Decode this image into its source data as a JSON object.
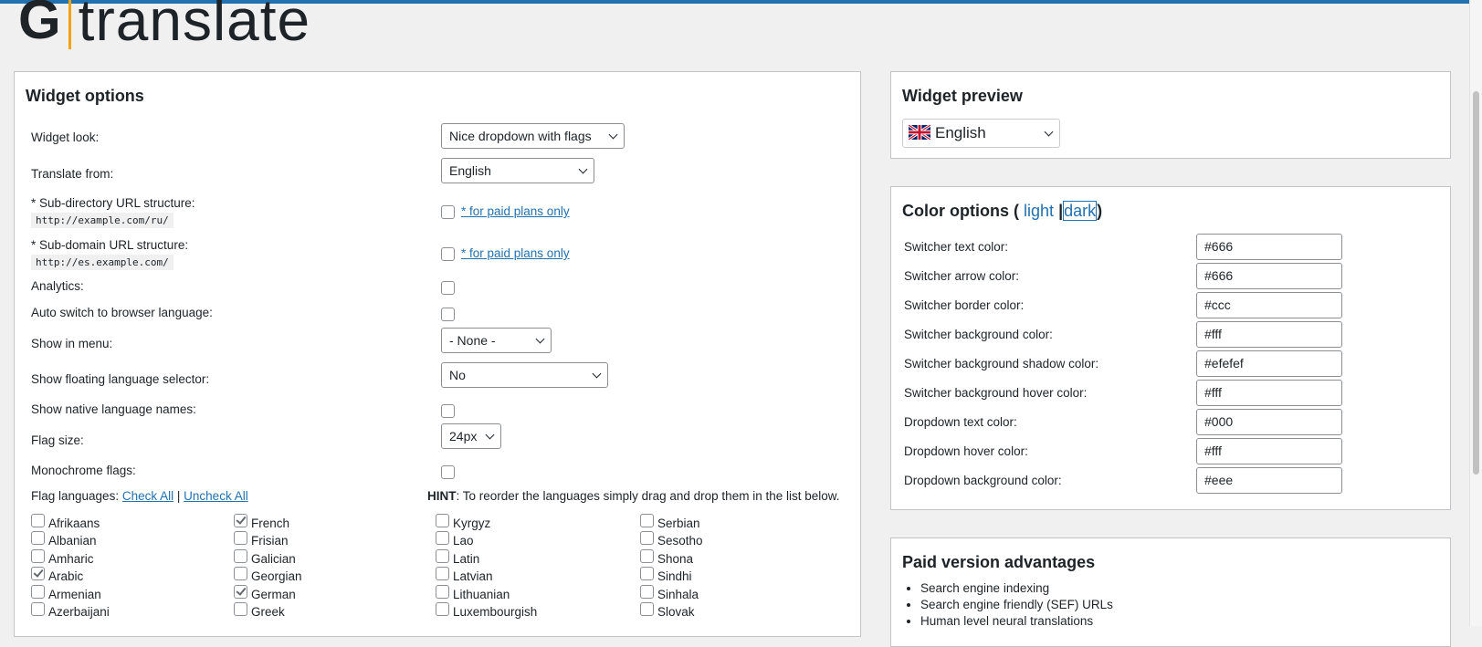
{
  "logo": {
    "mark": "G",
    "text": "translate"
  },
  "widget_options": {
    "title": "Widget options",
    "widget_look": {
      "label": "Widget look:",
      "value": "Nice dropdown with flags"
    },
    "translate_from": {
      "label": "Translate from:",
      "value": "English"
    },
    "subdirectory": {
      "label": "* Sub-directory URL structure:",
      "example": "http://example.com/ru/",
      "link": "* for paid plans only"
    },
    "subdomain": {
      "label": "* Sub-domain URL structure:",
      "example": "http://es.example.com/",
      "link": "* for paid plans only"
    },
    "analytics": {
      "label": "Analytics:"
    },
    "auto_switch": {
      "label": "Auto switch to browser language:"
    },
    "show_in_menu": {
      "label": "Show in menu:",
      "value": "- None -"
    },
    "floating": {
      "label": "Show floating language selector:",
      "value": "No"
    },
    "native_names": {
      "label": "Show native language names:"
    },
    "flag_size": {
      "label": "Flag size:",
      "value": "24px"
    },
    "monochrome": {
      "label": "Monochrome flags:"
    },
    "flag_languages": {
      "label": "Flag languages:",
      "check_all": "Check All",
      "separator": "|",
      "uncheck_all": "Uncheck All"
    },
    "hint": {
      "bold": "HINT",
      "text": ": To reorder the languages simply drag and drop them in the list below."
    },
    "languages": [
      [
        {
          "name": "Afrikaans",
          "checked": false
        },
        {
          "name": "Albanian",
          "checked": false
        },
        {
          "name": "Amharic",
          "checked": false
        },
        {
          "name": "Arabic",
          "checked": true
        },
        {
          "name": "Armenian",
          "checked": false
        },
        {
          "name": "Azerbaijani",
          "checked": false
        }
      ],
      [
        {
          "name": "French",
          "checked": true
        },
        {
          "name": "Frisian",
          "checked": false
        },
        {
          "name": "Galician",
          "checked": false
        },
        {
          "name": "Georgian",
          "checked": false
        },
        {
          "name": "German",
          "checked": true
        },
        {
          "name": "Greek",
          "checked": false
        }
      ],
      [
        {
          "name": "Kyrgyz",
          "checked": false
        },
        {
          "name": "Lao",
          "checked": false
        },
        {
          "name": "Latin",
          "checked": false
        },
        {
          "name": "Latvian",
          "checked": false
        },
        {
          "name": "Lithuanian",
          "checked": false
        },
        {
          "name": "Luxembourgish",
          "checked": false
        }
      ],
      [
        {
          "name": "Serbian",
          "checked": false
        },
        {
          "name": "Sesotho",
          "checked": false
        },
        {
          "name": "Shona",
          "checked": false
        },
        {
          "name": "Sindhi",
          "checked": false
        },
        {
          "name": "Sinhala",
          "checked": false
        },
        {
          "name": "Slovak",
          "checked": false
        }
      ]
    ]
  },
  "widget_preview": {
    "title": "Widget preview",
    "value": "English",
    "flag_icon": "uk-flag-icon"
  },
  "color_options": {
    "title": "Color options",
    "open": "(",
    "light": "light",
    "sep": "|",
    "dark": "dark",
    "close": ")",
    "fields": [
      {
        "label": "Switcher text color:",
        "value": "#666"
      },
      {
        "label": "Switcher arrow color:",
        "value": "#666"
      },
      {
        "label": "Switcher border color:",
        "value": "#ccc"
      },
      {
        "label": "Switcher background color:",
        "value": "#fff"
      },
      {
        "label": "Switcher background shadow color:",
        "value": "#efefef"
      },
      {
        "label": "Switcher background hover color:",
        "value": "#fff"
      },
      {
        "label": "Dropdown text color:",
        "value": "#000"
      },
      {
        "label": "Dropdown hover color:",
        "value": "#fff"
      },
      {
        "label": "Dropdown background color:",
        "value": "#eee"
      }
    ]
  },
  "paid_version": {
    "title": "Paid version advantages",
    "items": [
      "Search engine indexing",
      "Search engine friendly (SEF) URLs",
      "Human level neural translations"
    ]
  },
  "colors": {
    "accent": "#2271b1",
    "logo_bar": "#f2a30f"
  }
}
